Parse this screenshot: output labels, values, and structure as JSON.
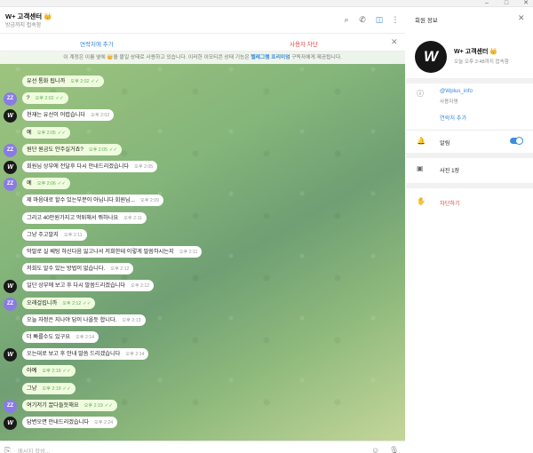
{
  "window": {
    "minimize": "–",
    "maximize": "□",
    "close": "✕"
  },
  "chat": {
    "title": "W+ 고객센터 👑",
    "subtitle": "방금까지 접속함",
    "actions": {
      "add_contact": "연락처에 추가",
      "block_user": "사용자 차단",
      "close": "✕"
    },
    "notice_prefix": "이 계정은 이름 옆에 👑을 붙일 상태로 사용하고 있습니다. 이러한 이모티콘 상태 기능은 ",
    "notice_link": "텔레그램 프리미엄",
    "notice_suffix": " 구독자에게 제공됩니다.",
    "composer_placeholder": "메시지 작성...",
    "messages": [
      {
        "sender": "zz",
        "avatar": "",
        "text": "유선 통화 됩니까",
        "time": "오후 2:02",
        "read": "✓✓"
      },
      {
        "sender": "zz",
        "avatar": "ZZ",
        "text": "?",
        "time": "오후 2:02",
        "read": "✓✓"
      },
      {
        "sender": "w",
        "avatar": "W",
        "text": "현재는 유선이 어렵습니다",
        "time": "오후 2:03",
        "read": ""
      },
      {
        "sender": "zz",
        "avatar": "",
        "text": "예",
        "time": "오후 2:05",
        "read": "✓✓"
      },
      {
        "sender": "zz",
        "avatar": "ZZ",
        "text": "원단 원금도 안주실거죠?",
        "time": "오후 2:05",
        "read": "✓✓"
      },
      {
        "sender": "w",
        "avatar": "W",
        "text": "회원님 상부에 전달후 다시 안내드리겠습니다",
        "time": "오후 2:05",
        "read": ""
      },
      {
        "sender": "zz",
        "avatar": "ZZ",
        "text": "예",
        "time": "오후 2:06",
        "read": "✓✓"
      },
      {
        "sender": "w",
        "avatar": "",
        "text": "제 마음대로 할수 있는부분이 아닙니다 회원님...",
        "time": "오후 2:09",
        "read": ""
      },
      {
        "sender": "w",
        "avatar": "",
        "text": "그리고 40만원가지고 먹튀해서 뭐하나요",
        "time": "오후 2:11",
        "read": ""
      },
      {
        "sender": "w",
        "avatar": "",
        "text": "그냥 주고말지",
        "time": "오후 2:11",
        "read": ""
      },
      {
        "sender": "w",
        "avatar": "",
        "text": "막말로 실 베팅 하신다음 잃고나서 저희한테 이렇게 말씀하시는지",
        "time": "오후 2:11",
        "read": ""
      },
      {
        "sender": "w",
        "avatar": "",
        "text": "저희도 알수 있는 방법이 없습니다.",
        "time": "오후 2:12",
        "read": ""
      },
      {
        "sender": "w",
        "avatar": "W",
        "text": "일단 상부에 보고 후 다시 말씀드리겠습니다",
        "time": "오후 2:12",
        "read": ""
      },
      {
        "sender": "zz",
        "avatar": "ZZ",
        "text": "오래걸립니까",
        "time": "오후 2:12",
        "read": "✓✓"
      },
      {
        "sender": "w",
        "avatar": "",
        "text": "오늘 자정은 지나야 답이 나올듯 합니다.",
        "time": "오후 2:13",
        "read": ""
      },
      {
        "sender": "w",
        "avatar": "",
        "text": "더 빠를수도 있구요",
        "time": "오후 2:14",
        "read": ""
      },
      {
        "sender": "w",
        "avatar": "W",
        "text": "오는대로 보고 후 안내 말씀 드리겠습니다",
        "time": "오후 2:14",
        "read": ""
      },
      {
        "sender": "zz",
        "avatar": "",
        "text": "아예",
        "time": "오후 2:19",
        "read": "✓✓"
      },
      {
        "sender": "zz",
        "avatar": "",
        "text": "그냥",
        "time": "오후 2:19",
        "read": "✓✓"
      },
      {
        "sender": "zz",
        "avatar": "ZZ",
        "text": "여기저기 끌다들듯해요",
        "time": "오후 2:19",
        "read": "✓✓"
      },
      {
        "sender": "w",
        "avatar": "W",
        "text": "답변오면 안내드리겠습니다",
        "time": "오후 2:24",
        "read": ""
      }
    ]
  },
  "profile": {
    "title": "회원 정보",
    "close": "✕",
    "avatar_letter": "W",
    "name": "W+ 고객센터 👑",
    "status": "오늘 오후 2:48까지 접속함",
    "username": "@Wplus_info",
    "username_label": "사용자명",
    "add_contact": "연락처 추가",
    "notifications_label": "알림",
    "notifications_on": true,
    "photos_label": "사진 1장",
    "block_label": "차단하기"
  }
}
